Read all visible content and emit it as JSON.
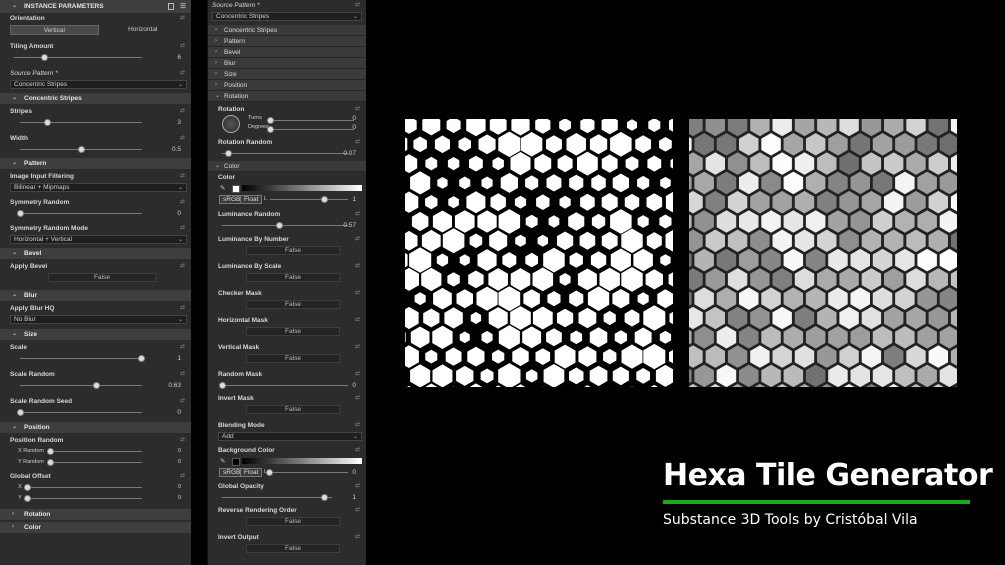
{
  "panel1": {
    "header": "INSTANCE PARAMETERS",
    "orientation": {
      "label": "Orientation",
      "options": [
        "Vertical",
        "Horizontal"
      ],
      "selected": "Vertical"
    },
    "tiling": {
      "label": "Tiling Amount",
      "value": "6",
      "fraction": 0.18
    },
    "source": {
      "label": "Source Pattern *",
      "value": "Concentric Stripes"
    },
    "concentric": {
      "header": "Concentric Stripes",
      "stripes": {
        "label": "Stripes",
        "value": "3",
        "fraction": 0.2
      },
      "width": {
        "label": "Width",
        "value": "0.5",
        "fraction": 0.5
      }
    },
    "pattern": {
      "header": "Pattern",
      "filtering": {
        "label": "Image Input Filtering",
        "value": "Bilinear + Mipmaps"
      },
      "symrandom": {
        "label": "Symmetry Random",
        "value": "0",
        "fraction": 0
      },
      "symmode": {
        "label": "Symmetry Random Mode",
        "value": "Horizontal + Vertical"
      }
    },
    "bevel": {
      "header": "Bevel",
      "apply": {
        "label": "Apply Bevel",
        "value": "False"
      }
    },
    "blur": {
      "header": "Blur",
      "apply": {
        "label": "Apply Blur HQ",
        "value": "No Blur"
      }
    },
    "size": {
      "header": "Size",
      "scale": {
        "label": "Scale",
        "value": "1",
        "fraction": 1
      },
      "scalerandom": {
        "label": "Scale Random",
        "value": "0.63",
        "fraction": 0.63
      },
      "seed": {
        "label": "Scale Random Seed",
        "value": "0",
        "fraction": 0
      }
    },
    "position": {
      "header": "Position",
      "posrandom": {
        "label": "Position Random",
        "x_label": "X Random",
        "x_value": "0",
        "y_label": "Y Random",
        "y_value": "0"
      },
      "offset": {
        "label": "Global Offset",
        "x_label": "X",
        "x_value": "0",
        "y_label": "Y",
        "y_value": "0"
      }
    },
    "rotation_header": "Rotation",
    "color_header": "Color"
  },
  "panel2": {
    "source": {
      "label": "Source Pattern *",
      "value": "Concentric Stripes"
    },
    "sections": [
      "Concentric Stripes",
      "Pattern",
      "Bevel",
      "Blur",
      "Size",
      "Position",
      "Rotation"
    ],
    "rotation": {
      "label": "Rotation",
      "turns_label": "Turns",
      "turns_value": "0",
      "degrees_label": "Degrees",
      "degrees_value": "0",
      "random_label": "Rotation Random",
      "random_value": "0.07",
      "random_fraction": 0.07
    },
    "color": {
      "header": "Color",
      "label": "Color",
      "srgb": "sRGB",
      "float": "Float",
      "l_label": "L",
      "l_value": "1",
      "l_fraction": 1,
      "lum_random": {
        "label": "Luminance Random",
        "value": "0.57",
        "fraction": 0.57
      },
      "lum_number": {
        "label": "Luminance By Number",
        "value": "False"
      },
      "lum_scale": {
        "label": "Luminance By Scale",
        "value": "False"
      },
      "checker": {
        "label": "Checker Mask",
        "value": "False"
      },
      "hmask": {
        "label": "Horizontal Mask",
        "value": "False"
      },
      "vmask": {
        "label": "Vertical Mask",
        "value": "False"
      },
      "rmask": {
        "label": "Random Mask",
        "value": "0",
        "fraction": 0
      },
      "invert": {
        "label": "Invert Mask",
        "value": "False"
      },
      "blend": {
        "label": "Blending Mode",
        "value": "Add"
      },
      "bg": {
        "label": "Background Color",
        "srgb": "sRGB",
        "float": "Float",
        "l_label": "L",
        "l_value": "0",
        "l_fraction": 0
      },
      "opacity": {
        "label": "Global Opacity",
        "value": "1",
        "fraction": 1
      },
      "reverse": {
        "label": "Reverse Rendering Order",
        "value": "False"
      },
      "invout": {
        "label": "Invert Output",
        "value": "False"
      }
    }
  },
  "branding": {
    "title": "Hexa Tile Generator",
    "subtitle": "Substance 3D Tools by Cristóbal Vila",
    "accent": "#1fa81f"
  }
}
